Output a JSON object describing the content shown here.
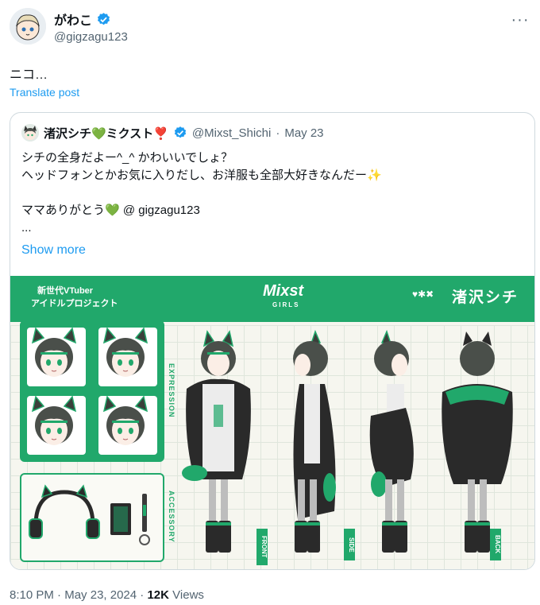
{
  "author": {
    "name": "がわこ",
    "handle": "@gigzagu123",
    "verified": true
  },
  "tweet": {
    "text": "ニコ…",
    "translate_label": "Translate post"
  },
  "quoted": {
    "name": "渚沢シチ💚ミクスト❣️",
    "handle": "@Mixst_Shichi",
    "separator": "·",
    "date": "May 23",
    "lines": [
      "シチの全身だよー^_^ かわいいでしょ？",
      "ヘッドフォンとかお気に入りだし、お洋服も全部大好きなんだー✨",
      "",
      "ママありがとう💚 @ gigzagu123",
      "..."
    ],
    "show_more": "Show more"
  },
  "artwork": {
    "banner_left_line1": "新世代VTuber",
    "banner_left_line2": "アイドルプロジェクト",
    "banner_logo": "Mixst",
    "banner_logo_sub": "GIRLS",
    "banner_marks": "♥✱✖",
    "banner_name": "渚沢シチ",
    "label_expression": "EXPRESSION",
    "label_accessory": "ACCESSORY",
    "label_front": "FRONT",
    "label_side": "SIDE",
    "label_back": "BACK",
    "colors": {
      "brand_green": "#21a86b",
      "hair": "#4a4f4a",
      "jacket": "#2a2a2a"
    }
  },
  "footer": {
    "time": "8:10 PM",
    "separator": "·",
    "date": "May 23, 2024",
    "views_count": "12K",
    "views_label": "Views"
  }
}
